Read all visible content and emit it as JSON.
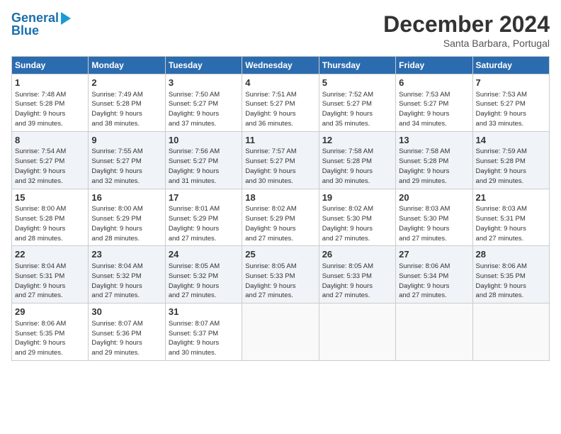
{
  "header": {
    "logo_line1": "General",
    "logo_line2": "Blue",
    "main_title": "December 2024",
    "subtitle": "Santa Barbara, Portugal"
  },
  "days_of_week": [
    "Sunday",
    "Monday",
    "Tuesday",
    "Wednesday",
    "Thursday",
    "Friday",
    "Saturday"
  ],
  "weeks": [
    [
      {
        "day": "1",
        "info": "Sunrise: 7:48 AM\nSunset: 5:28 PM\nDaylight: 9 hours\nand 39 minutes."
      },
      {
        "day": "2",
        "info": "Sunrise: 7:49 AM\nSunset: 5:28 PM\nDaylight: 9 hours\nand 38 minutes."
      },
      {
        "day": "3",
        "info": "Sunrise: 7:50 AM\nSunset: 5:27 PM\nDaylight: 9 hours\nand 37 minutes."
      },
      {
        "day": "4",
        "info": "Sunrise: 7:51 AM\nSunset: 5:27 PM\nDaylight: 9 hours\nand 36 minutes."
      },
      {
        "day": "5",
        "info": "Sunrise: 7:52 AM\nSunset: 5:27 PM\nDaylight: 9 hours\nand 35 minutes."
      },
      {
        "day": "6",
        "info": "Sunrise: 7:53 AM\nSunset: 5:27 PM\nDaylight: 9 hours\nand 34 minutes."
      },
      {
        "day": "7",
        "info": "Sunrise: 7:53 AM\nSunset: 5:27 PM\nDaylight: 9 hours\nand 33 minutes."
      }
    ],
    [
      {
        "day": "8",
        "info": "Sunrise: 7:54 AM\nSunset: 5:27 PM\nDaylight: 9 hours\nand 32 minutes."
      },
      {
        "day": "9",
        "info": "Sunrise: 7:55 AM\nSunset: 5:27 PM\nDaylight: 9 hours\nand 32 minutes."
      },
      {
        "day": "10",
        "info": "Sunrise: 7:56 AM\nSunset: 5:27 PM\nDaylight: 9 hours\nand 31 minutes."
      },
      {
        "day": "11",
        "info": "Sunrise: 7:57 AM\nSunset: 5:27 PM\nDaylight: 9 hours\nand 30 minutes."
      },
      {
        "day": "12",
        "info": "Sunrise: 7:58 AM\nSunset: 5:28 PM\nDaylight: 9 hours\nand 30 minutes."
      },
      {
        "day": "13",
        "info": "Sunrise: 7:58 AM\nSunset: 5:28 PM\nDaylight: 9 hours\nand 29 minutes."
      },
      {
        "day": "14",
        "info": "Sunrise: 7:59 AM\nSunset: 5:28 PM\nDaylight: 9 hours\nand 29 minutes."
      }
    ],
    [
      {
        "day": "15",
        "info": "Sunrise: 8:00 AM\nSunset: 5:28 PM\nDaylight: 9 hours\nand 28 minutes."
      },
      {
        "day": "16",
        "info": "Sunrise: 8:00 AM\nSunset: 5:29 PM\nDaylight: 9 hours\nand 28 minutes."
      },
      {
        "day": "17",
        "info": "Sunrise: 8:01 AM\nSunset: 5:29 PM\nDaylight: 9 hours\nand 27 minutes."
      },
      {
        "day": "18",
        "info": "Sunrise: 8:02 AM\nSunset: 5:29 PM\nDaylight: 9 hours\nand 27 minutes."
      },
      {
        "day": "19",
        "info": "Sunrise: 8:02 AM\nSunset: 5:30 PM\nDaylight: 9 hours\nand 27 minutes."
      },
      {
        "day": "20",
        "info": "Sunrise: 8:03 AM\nSunset: 5:30 PM\nDaylight: 9 hours\nand 27 minutes."
      },
      {
        "day": "21",
        "info": "Sunrise: 8:03 AM\nSunset: 5:31 PM\nDaylight: 9 hours\nand 27 minutes."
      }
    ],
    [
      {
        "day": "22",
        "info": "Sunrise: 8:04 AM\nSunset: 5:31 PM\nDaylight: 9 hours\nand 27 minutes."
      },
      {
        "day": "23",
        "info": "Sunrise: 8:04 AM\nSunset: 5:32 PM\nDaylight: 9 hours\nand 27 minutes."
      },
      {
        "day": "24",
        "info": "Sunrise: 8:05 AM\nSunset: 5:32 PM\nDaylight: 9 hours\nand 27 minutes."
      },
      {
        "day": "25",
        "info": "Sunrise: 8:05 AM\nSunset: 5:33 PM\nDaylight: 9 hours\nand 27 minutes."
      },
      {
        "day": "26",
        "info": "Sunrise: 8:05 AM\nSunset: 5:33 PM\nDaylight: 9 hours\nand 27 minutes."
      },
      {
        "day": "27",
        "info": "Sunrise: 8:06 AM\nSunset: 5:34 PM\nDaylight: 9 hours\nand 27 minutes."
      },
      {
        "day": "28",
        "info": "Sunrise: 8:06 AM\nSunset: 5:35 PM\nDaylight: 9 hours\nand 28 minutes."
      }
    ],
    [
      {
        "day": "29",
        "info": "Sunrise: 8:06 AM\nSunset: 5:35 PM\nDaylight: 9 hours\nand 29 minutes."
      },
      {
        "day": "30",
        "info": "Sunrise: 8:07 AM\nSunset: 5:36 PM\nDaylight: 9 hours\nand 29 minutes."
      },
      {
        "day": "31",
        "info": "Sunrise: 8:07 AM\nSunset: 5:37 PM\nDaylight: 9 hours\nand 30 minutes."
      },
      null,
      null,
      null,
      null
    ]
  ]
}
